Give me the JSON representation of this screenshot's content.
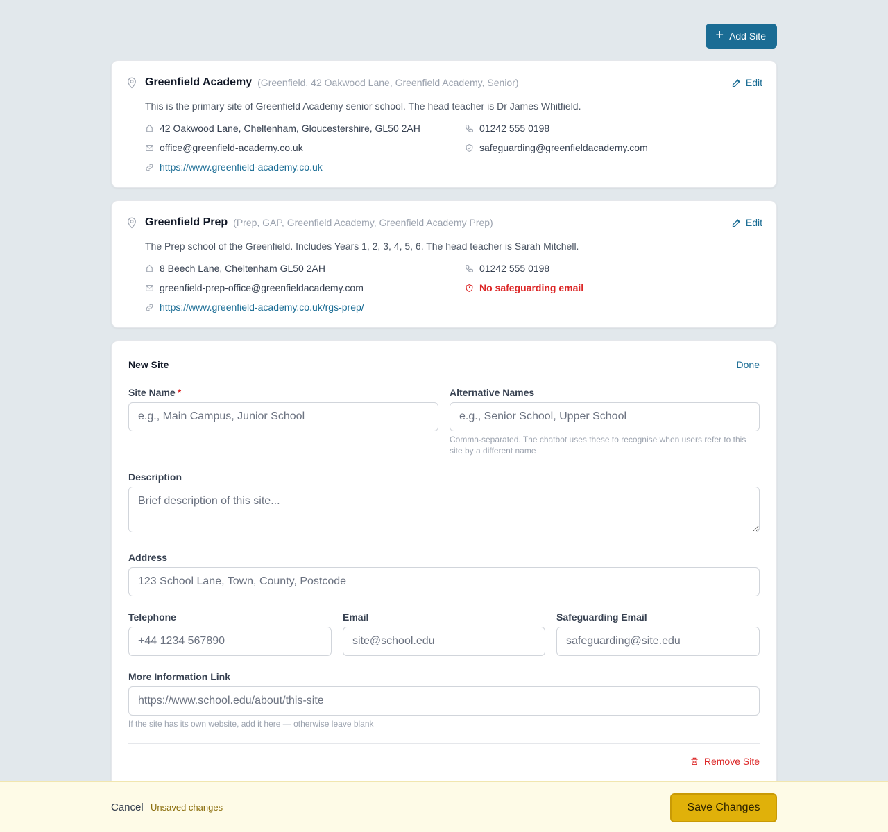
{
  "toolbar": {
    "add_site_label": "Add Site"
  },
  "sites": [
    {
      "name": "Greenfield Academy",
      "alt_names": "(Greenfield, 42 Oakwood Lane, Greenfield Academy, Senior)",
      "edit_label": "Edit",
      "description": "This is the primary site of Greenfield Academy senior school. The head teacher is Dr James Whitfield.",
      "address": "42 Oakwood Lane, Cheltenham, Gloucestershire, GL50 2AH",
      "telephone": "01242 555 0198",
      "email": "office@greenfield-academy.co.uk",
      "safeguarding": "safeguarding@greenfieldacademy.com",
      "website": "https://www.greenfield-academy.co.uk"
    },
    {
      "name": "Greenfield Prep",
      "alt_names": "(Prep, GAP, Greenfield Academy, Greenfield Academy Prep)",
      "edit_label": "Edit",
      "description": "The Prep school of the Greenfield. Includes Years 1, 2, 3, 4, 5, 6. The head teacher is Sarah Mitchell.",
      "address": "8 Beech Lane, Cheltenham GL50 2AH",
      "telephone": "01242 555 0198",
      "email": "greenfield-prep-office@greenfieldacademy.com",
      "safeguarding": "No safeguarding email",
      "website": "https://www.greenfield-academy.co.uk/rgs-prep/"
    }
  ],
  "new_site": {
    "title": "New Site",
    "done_label": "Done",
    "site_name": {
      "label": "Site Name",
      "required_mark": "*",
      "placeholder": "e.g., Main Campus, Junior School",
      "value": ""
    },
    "alt_names": {
      "label": "Alternative Names",
      "placeholder": "e.g., Senior School, Upper School",
      "value": "",
      "hint": "Comma-separated. The chatbot uses these to recognise when users refer to this site by a different name"
    },
    "description": {
      "label": "Description",
      "placeholder": "Brief description of this site...",
      "value": ""
    },
    "address": {
      "label": "Address",
      "placeholder": "123 School Lane, Town, County, Postcode",
      "value": ""
    },
    "telephone": {
      "label": "Telephone",
      "placeholder": "+44 1234 567890",
      "value": ""
    },
    "email": {
      "label": "Email",
      "placeholder": "site@school.edu",
      "value": ""
    },
    "safeguarding": {
      "label": "Safeguarding Email",
      "placeholder": "safeguarding@site.edu",
      "value": ""
    },
    "more_info": {
      "label": "More Information Link",
      "placeholder": "https://www.school.edu/about/this-site",
      "value": "",
      "hint": "If the site has its own website, add it here — otherwise leave blank"
    },
    "remove_label": "Remove Site"
  },
  "footer": {
    "cancel_label": "Cancel",
    "status": "Unsaved changes",
    "save_label": "Save Changes"
  },
  "colors": {
    "accent": "#1a6c94",
    "danger": "#dc2626",
    "save": "#e0b10a",
    "footer_bg": "#fefbe7"
  },
  "icons": [
    "plus-icon",
    "map-pin-icon",
    "pencil-icon",
    "home-icon",
    "phone-icon",
    "mail-icon",
    "shield-icon",
    "link-icon",
    "trash-icon"
  ]
}
